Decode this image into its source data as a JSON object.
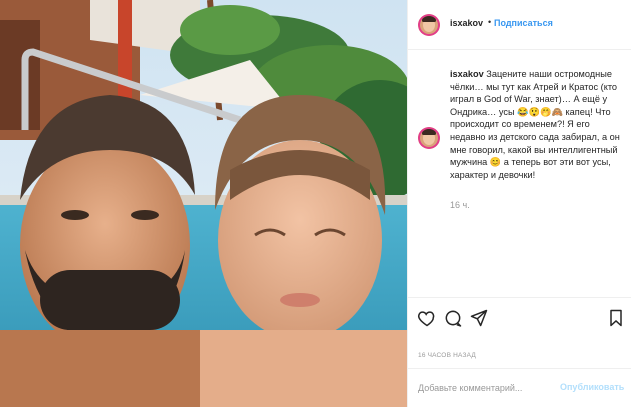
{
  "post": {
    "username": "isxakov",
    "separator": "•",
    "follow_label": "Подписаться",
    "caption_username": "isxakov",
    "caption_text": "Зацените наши остромодные чёлки… мы тут как Атрей и Кратос (кто играл в God of War, знает)… А ещё у Ондрика… усы 😂😲🤭🙈 капец! Что происходит со временем?! Я его недавно из детского сада забирал, а он мне говорил, какой вы интеллигентный мужчина 😊 а теперь вот эти вот усы, характер и девочки!",
    "caption_time": "16 ч.",
    "post_time": "16 ЧАСОВ НАЗАД",
    "comment_placeholder": "Добавьте комментарий...",
    "publish_label": "Опубликовать"
  },
  "icons": {
    "like": "heart-icon",
    "comment": "comment-icon",
    "share": "share-icon",
    "save": "bookmark-icon"
  },
  "colors": {
    "accent": "#3897f0",
    "publish_disabled": "#b2dffc",
    "muted": "#999999",
    "text": "#262626"
  }
}
